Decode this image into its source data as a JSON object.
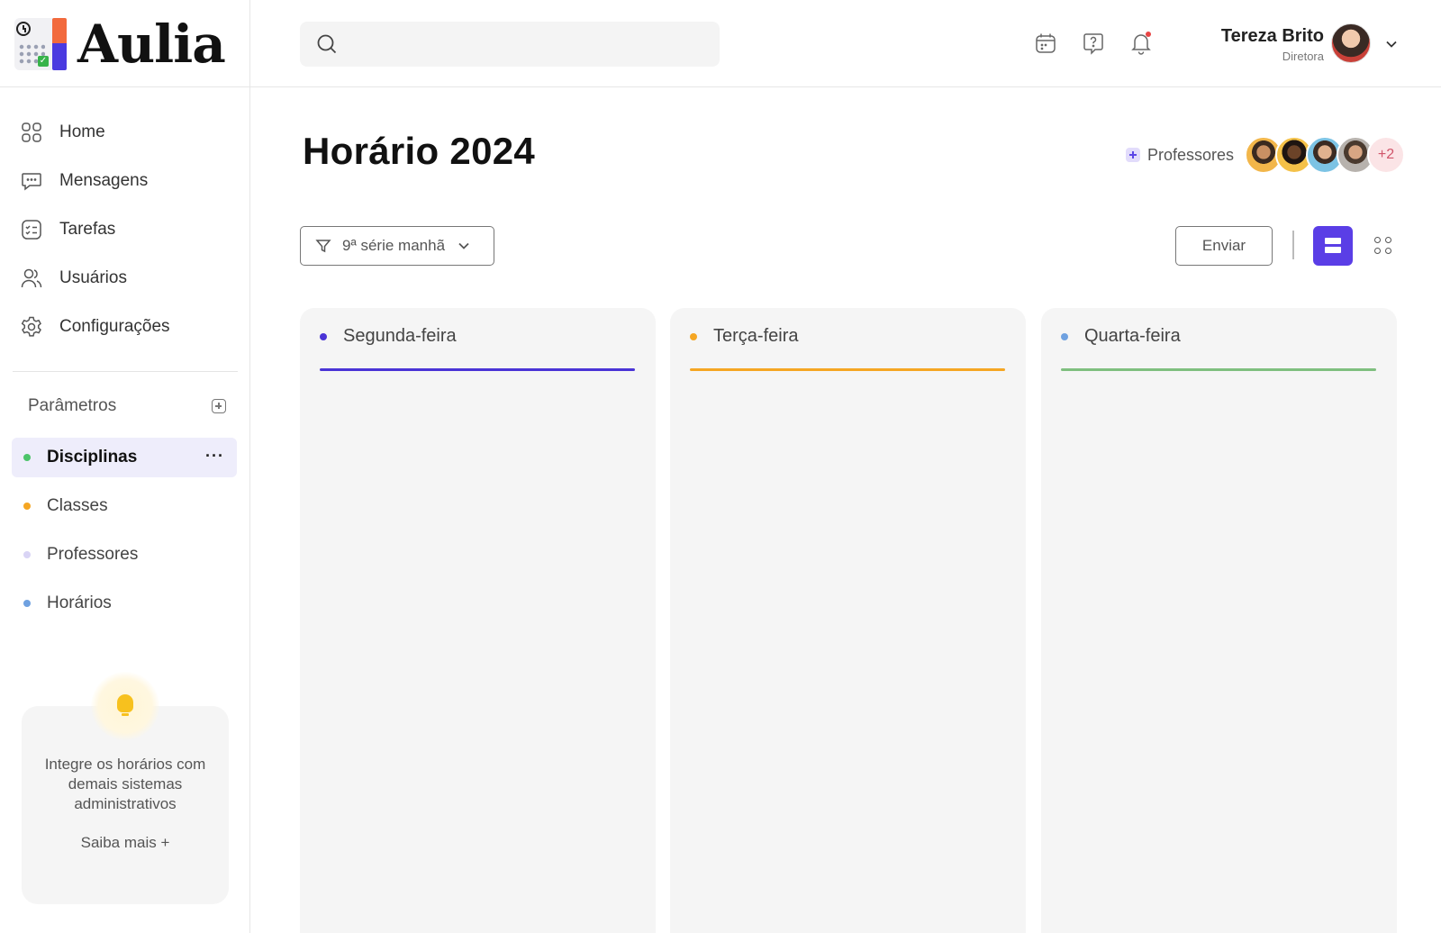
{
  "app": {
    "name": "Aulia"
  },
  "sidebar": {
    "nav": [
      {
        "label": "Home",
        "icon": "grid-icon"
      },
      {
        "label": "Mensagens",
        "icon": "chat-icon"
      },
      {
        "label": "Tarefas",
        "icon": "tasks-icon"
      },
      {
        "label": "Usuários",
        "icon": "users-icon"
      },
      {
        "label": "Configurações",
        "icon": "gear-icon"
      }
    ],
    "params_title": "Parâmetros",
    "params": [
      {
        "label": "Disciplinas",
        "color": "#4cc46a",
        "active": true
      },
      {
        "label": "Classes",
        "color": "#f5a623"
      },
      {
        "label": "Professores",
        "color": "#d9d4f5"
      },
      {
        "label": "Horários",
        "color": "#6fa1e0"
      }
    ],
    "promo": {
      "text": "Integre os horários com demais sistemas administrativos",
      "link": "Saiba mais +"
    }
  },
  "topbar": {
    "search_placeholder": "",
    "icons": [
      "calendar-icon",
      "help-chat-icon",
      "bell-icon"
    ],
    "user": {
      "name": "Tereza Brito",
      "role": "Diretora"
    }
  },
  "main": {
    "title": "Horário 2024",
    "teachers_label": "Professores",
    "teachers_more": "+2",
    "filter_label": "9ª série manhã",
    "send_label": "Enviar",
    "accent": "#5a3ee6",
    "days": [
      {
        "name": "Segunda-feira",
        "color": "#4a34d6"
      },
      {
        "name": "Terça-feira",
        "color": "#f5a623"
      },
      {
        "name": "Quarta-feira",
        "color": "#7fbf7f"
      }
    ],
    "day_dot_colors": [
      "#4a34d6",
      "#f5a623",
      "#6fa1e0"
    ]
  }
}
